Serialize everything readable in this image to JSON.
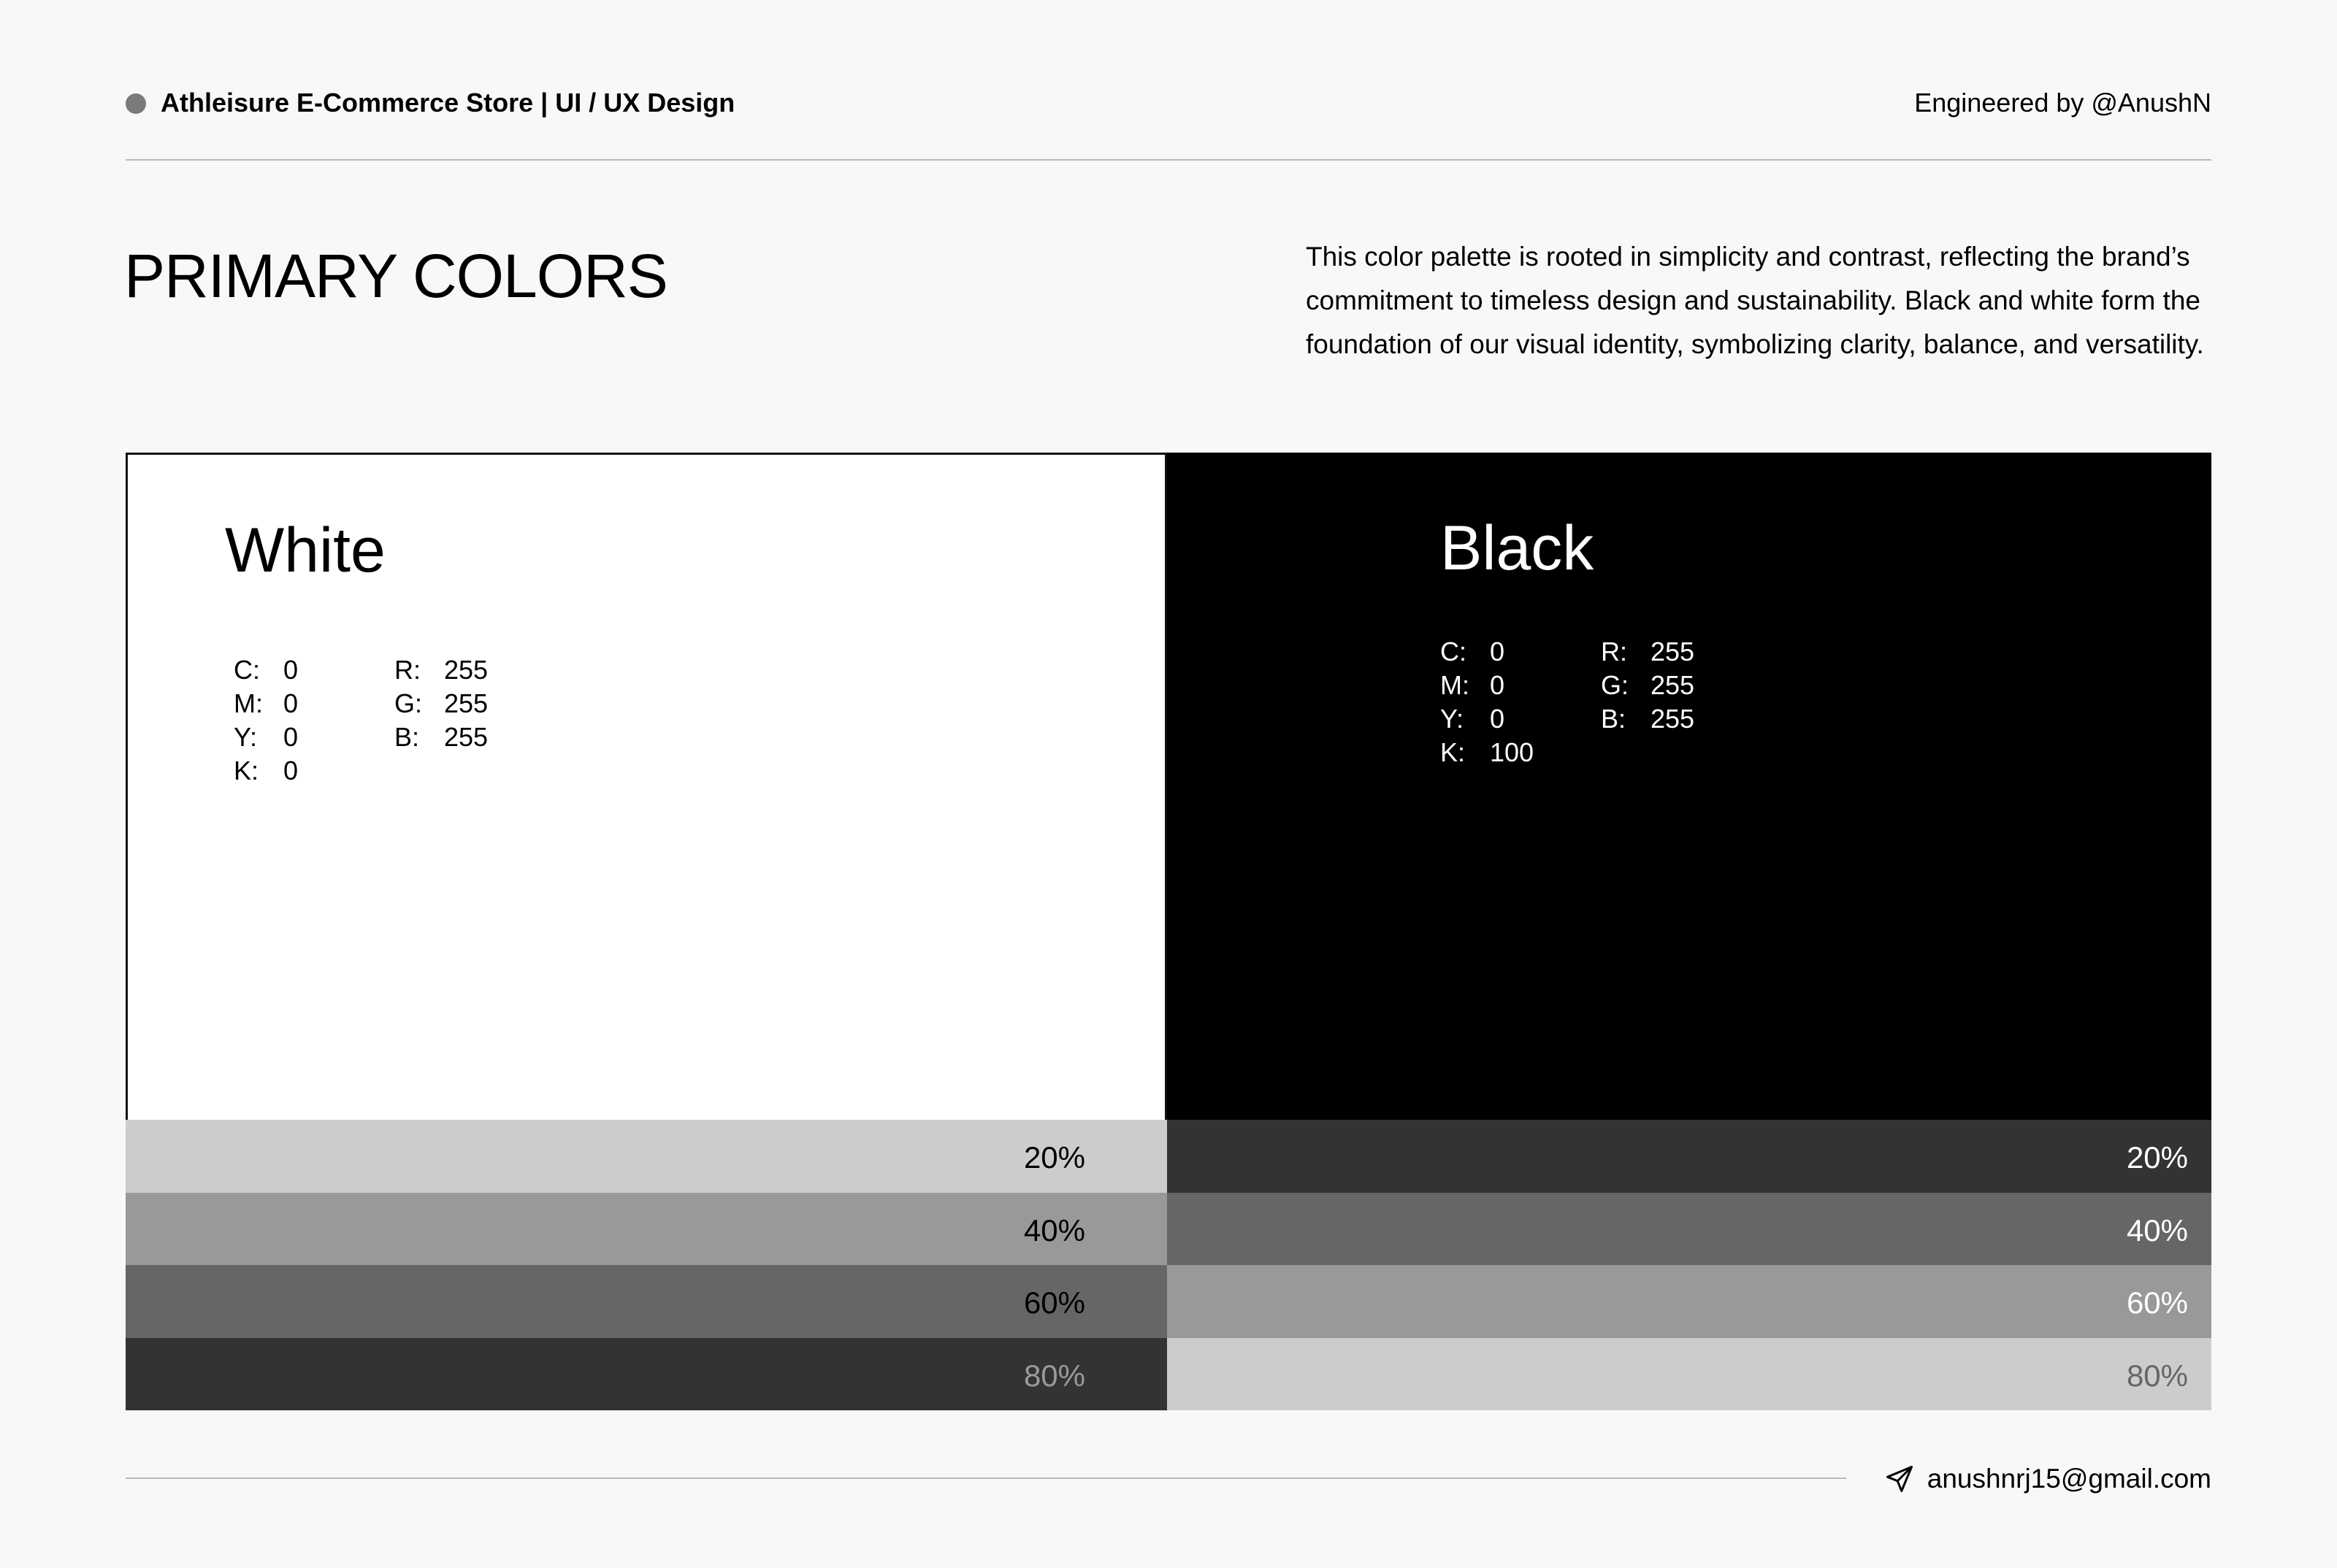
{
  "header": {
    "title": "Athleisure E-Commerce Store | UI / UX Design",
    "credit": "Engineered by @AnushN",
    "dot_color": "#7a7a7a"
  },
  "page": {
    "title": "PRIMARY COLORS",
    "description": "This color palette is rooted in simplicity and contrast, reflecting the brand’s commitment to timeless design and sustainability. Black and white form the foundation of our visual identity, symbolizing clarity, balance, and versatility."
  },
  "swatches": [
    {
      "name": "White",
      "color": "#ffffff",
      "text_color": "#000000",
      "cmyk": [
        {
          "key": "C:",
          "value": "0"
        },
        {
          "key": "M:",
          "value": "0"
        },
        {
          "key": "Y:",
          "value": "0"
        },
        {
          "key": "K:",
          "value": "0"
        }
      ],
      "rgb": [
        {
          "key": "R:",
          "value": "255"
        },
        {
          "key": "G:",
          "value": "255"
        },
        {
          "key": "B:",
          "value": "255"
        }
      ],
      "tints": [
        {
          "label": "20%",
          "color": "#cccccc",
          "text_color": "#000000"
        },
        {
          "label": "40%",
          "color": "#999999",
          "text_color": "#000000"
        },
        {
          "label": "60%",
          "color": "#666666",
          "text_color": "#000000"
        },
        {
          "label": "80%",
          "color": "#333333",
          "text_color": "#9a9a9a"
        }
      ]
    },
    {
      "name": "Black",
      "color": "#000000",
      "text_color": "#ffffff",
      "cmyk": [
        {
          "key": "C:",
          "value": "0"
        },
        {
          "key": "M:",
          "value": "0"
        },
        {
          "key": "Y:",
          "value": "0"
        },
        {
          "key": "K:",
          "value": "100"
        }
      ],
      "rgb": [
        {
          "key": "R:",
          "value": "255"
        },
        {
          "key": "G:",
          "value": "255"
        },
        {
          "key": "B:",
          "value": "255"
        }
      ],
      "tints": [
        {
          "label": "20%",
          "color": "#333333",
          "text_color": "#ffffff"
        },
        {
          "label": "40%",
          "color": "#666666",
          "text_color": "#ffffff"
        },
        {
          "label": "60%",
          "color": "#999999",
          "text_color": "#ffffff"
        },
        {
          "label": "80%",
          "color": "#cccccc",
          "text_color": "#666666"
        }
      ]
    }
  ],
  "footer": {
    "icon": "send-icon",
    "email": "anushnrj15@gmail.com"
  }
}
